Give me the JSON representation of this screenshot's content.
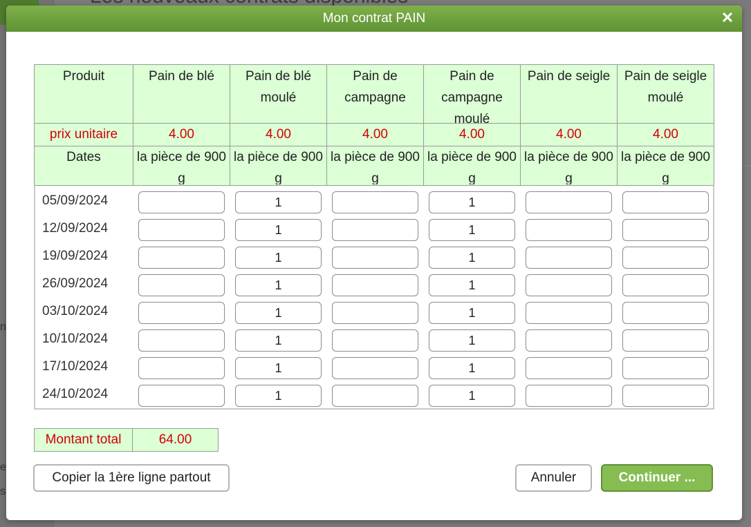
{
  "background": {
    "title": "Les nouveaux contrats disponibles",
    "fragments": [
      "nt",
      "es",
      "s"
    ]
  },
  "dialog": {
    "title": "Mon contrat PAIN",
    "close_icon": "close-icon"
  },
  "header": {
    "product_label": "Produit",
    "price_label": "prix unitaire",
    "dates_label": "Dates",
    "products": [
      {
        "name": "Pain de blé",
        "price": "4.00",
        "unit": "la pièce de 900 g"
      },
      {
        "name": "Pain de blé moulé",
        "price": "4.00",
        "unit": "la pièce de 900 g"
      },
      {
        "name": "Pain de campagne",
        "price": "4.00",
        "unit": "la pièce de 900 g"
      },
      {
        "name": "Pain de campagne moulé",
        "price": "4.00",
        "unit": "la pièce de 900 g"
      },
      {
        "name": "Pain de seigle",
        "price": "4.00",
        "unit": "la pièce de 900 g"
      },
      {
        "name": "Pain de seigle moulé",
        "price": "4.00",
        "unit": "la pièce de 900 g"
      }
    ]
  },
  "rows": [
    {
      "date": "05/09/2024",
      "qty": [
        "",
        "1",
        "",
        "1",
        "",
        ""
      ]
    },
    {
      "date": "12/09/2024",
      "qty": [
        "",
        "1",
        "",
        "1",
        "",
        ""
      ]
    },
    {
      "date": "19/09/2024",
      "qty": [
        "",
        "1",
        "",
        "1",
        "",
        ""
      ]
    },
    {
      "date": "26/09/2024",
      "qty": [
        "",
        "1",
        "",
        "1",
        "",
        ""
      ]
    },
    {
      "date": "03/10/2024",
      "qty": [
        "",
        "1",
        "",
        "1",
        "",
        ""
      ]
    },
    {
      "date": "10/10/2024",
      "qty": [
        "",
        "1",
        "",
        "1",
        "",
        ""
      ]
    },
    {
      "date": "17/10/2024",
      "qty": [
        "",
        "1",
        "",
        "1",
        "",
        ""
      ]
    },
    {
      "date": "24/10/2024",
      "qty": [
        "",
        "1",
        "",
        "1",
        "",
        ""
      ]
    }
  ],
  "total": {
    "label": "Montant total",
    "value": "64.00"
  },
  "buttons": {
    "copy": "Copier la 1ère ligne partout",
    "cancel": "Annuler",
    "continue": "Continuer ..."
  },
  "colors": {
    "titlebar": "#6ea23f",
    "header_bg": "#dcffd6",
    "price_text": "#d40000",
    "continue_bg": "#86bd52"
  }
}
